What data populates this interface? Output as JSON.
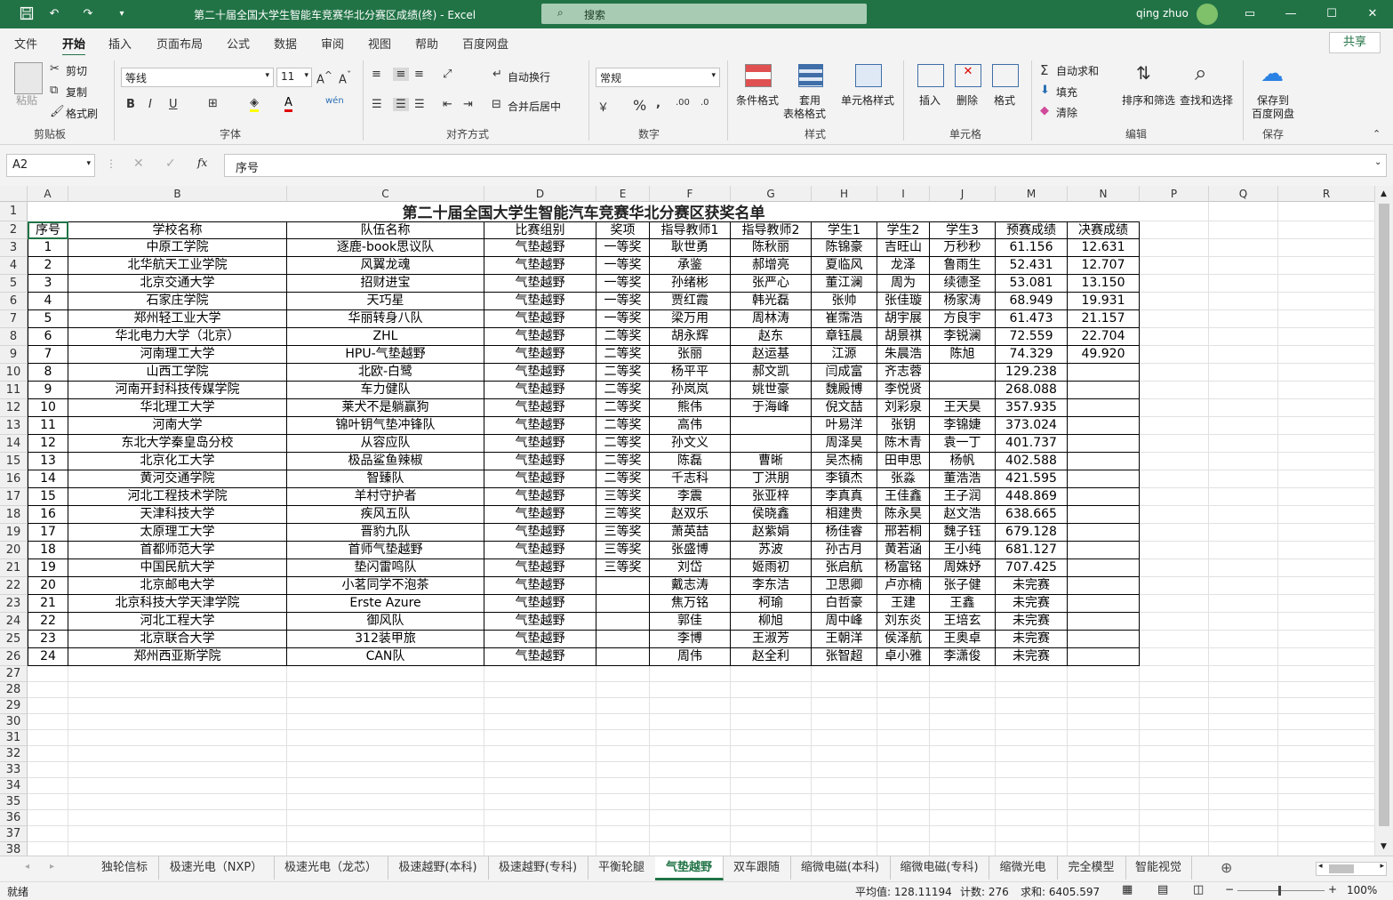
{
  "app": {
    "title": "第二十届全国大学生智能车竞赛华北分赛区成绩(终) - Excel",
    "search_placeholder": "搜索",
    "user": "qing zhuo",
    "accent": "#217346"
  },
  "ribbon": {
    "tabs": [
      "文件",
      "开始",
      "插入",
      "页面布局",
      "公式",
      "数据",
      "审阅",
      "视图",
      "帮助",
      "百度网盘"
    ],
    "active_tab": "开始",
    "share": "共享",
    "clipboard": {
      "paste": "粘贴",
      "cut": "剪切",
      "copy": "复制",
      "format_painter": "格式刷",
      "label": "剪贴板"
    },
    "font": {
      "name": "等线",
      "size": "11",
      "label": "字体"
    },
    "alignment": {
      "wrap": "自动换行",
      "merge": "合并后居中",
      "label": "对齐方式"
    },
    "number": {
      "format": "常规",
      "label": "数字"
    },
    "styles": {
      "conditional": "条件格式",
      "table_line1": "套用",
      "table_line2": "表格格式",
      "cell_styles": "单元格样式",
      "label": "样式"
    },
    "cells": {
      "insert": "插入",
      "delete": "删除",
      "format": "格式",
      "label": "单元格"
    },
    "editing": {
      "autosum": "自动求和",
      "fill": "填充",
      "clear": "清除",
      "sort": "排序和筛选",
      "find": "查找和选择",
      "label": "编辑"
    },
    "save": {
      "line1": "保存到",
      "line2": "百度网盘",
      "label": "保存"
    }
  },
  "formula_bar": {
    "name_box": "A2",
    "fx": "fx",
    "content": "序号"
  },
  "columns": [
    "A",
    "B",
    "C",
    "D",
    "E",
    "F",
    "G",
    "H",
    "I",
    "J",
    "M",
    "N",
    "P",
    "Q",
    "R"
  ],
  "sheet_title": "第二十届全国大学生智能汽车竞赛华北分赛区获奖名单",
  "table": {
    "headers": [
      "序号",
      "学校名称",
      "队伍名称",
      "比赛组别",
      "奖项",
      "指导教师1",
      "指导教师2",
      "学生1",
      "学生2",
      "学生3",
      "预赛成绩",
      "决赛成绩"
    ],
    "rows": [
      [
        "1",
        "中原工学院",
        "逐鹿-book思议队",
        "气垫越野",
        "一等奖",
        "耿世勇",
        "陈秋丽",
        "陈锦豪",
        "吉旺山",
        "万秒秒",
        "61.156",
        "12.631"
      ],
      [
        "2",
        "北华航天工业学院",
        "风翼龙魂",
        "气垫越野",
        "一等奖",
        "承鉴",
        "郝增亮",
        "夏临风",
        "龙泽",
        "鲁雨生",
        "52.431",
        "12.707"
      ],
      [
        "3",
        "北京交通大学",
        "招财进宝",
        "气垫越野",
        "一等奖",
        "孙绪彬",
        "张严心",
        "董江澜",
        "周为",
        "续德圣",
        "53.081",
        "13.150"
      ],
      [
        "4",
        "石家庄学院",
        "天巧星",
        "气垫越野",
        "一等奖",
        "贾红霞",
        "韩光磊",
        "张帅",
        "张佳璇",
        "杨家涛",
        "68.949",
        "19.931"
      ],
      [
        "5",
        "郑州轻工业大学",
        "华丽转身八队",
        "气垫越野",
        "一等奖",
        "梁万用",
        "周林涛",
        "崔霈浩",
        "胡宇展",
        "方良宇",
        "61.473",
        "21.157"
      ],
      [
        "6",
        "华北电力大学（北京）",
        "ZHL",
        "气垫越野",
        "二等奖",
        "胡永辉",
        "赵东",
        "章钰晨",
        "胡景祺",
        "李锐澜",
        "72.559",
        "22.704"
      ],
      [
        "7",
        "河南理工大学",
        "HPU-气垫越野",
        "气垫越野",
        "二等奖",
        "张丽",
        "赵运基",
        "江源",
        "朱晨浩",
        "陈旭",
        "74.329",
        "49.920"
      ],
      [
        "8",
        "山西工学院",
        "北欧-白鹭",
        "气垫越野",
        "二等奖",
        "杨平平",
        "郝文凯",
        "闫成富",
        "齐志蓉",
        "",
        "129.238",
        ""
      ],
      [
        "9",
        "河南开封科技传媒学院",
        "车力健队",
        "气垫越野",
        "二等奖",
        "孙岚岚",
        "姚世豪",
        "魏殿博",
        "李悦贤",
        "",
        "268.088",
        ""
      ],
      [
        "10",
        "华北理工大学",
        "莱犬不是躺赢狗",
        "气垫越野",
        "二等奖",
        "熊伟",
        "于海峰",
        "倪文喆",
        "刘彩泉",
        "王天昊",
        "357.935",
        ""
      ],
      [
        "11",
        "河南大学",
        "锦叶钥气垫冲锋队",
        "气垫越野",
        "二等奖",
        "高伟",
        "",
        "叶易洋",
        "张钥",
        "李锦婕",
        "373.024",
        ""
      ],
      [
        "12",
        "东北大学秦皇岛分校",
        "从容应队",
        "气垫越野",
        "二等奖",
        "孙文义",
        "",
        "周泽昊",
        "陈木青",
        "袁一丁",
        "401.737",
        ""
      ],
      [
        "13",
        "北京化工大学",
        "极品鲨鱼辣椒",
        "气垫越野",
        "二等奖",
        "陈磊",
        "曹晰",
        "吴杰楠",
        "田申思",
        "杨帆",
        "402.588",
        ""
      ],
      [
        "14",
        "黄河交通学院",
        "智臻队",
        "气垫越野",
        "二等奖",
        "千志科",
        "丁洪朋",
        "李镇杰",
        "张淼",
        "董浩浩",
        "421.595",
        ""
      ],
      [
        "15",
        "河北工程技术学院",
        "羊村守护者",
        "气垫越野",
        "三等奖",
        "李震",
        "张亚梓",
        "李真真",
        "王佳鑫",
        "王子润",
        "448.869",
        ""
      ],
      [
        "16",
        "天津科技大学",
        "疾风五队",
        "气垫越野",
        "三等奖",
        "赵双乐",
        "侯晓鑫",
        "相建贵",
        "陈永昊",
        "赵文浩",
        "638.665",
        ""
      ],
      [
        "17",
        "太原理工大学",
        "晋豹九队",
        "气垫越野",
        "三等奖",
        "萧英喆",
        "赵紫娟",
        "杨佳睿",
        "邢若桐",
        "魏子钰",
        "679.128",
        ""
      ],
      [
        "18",
        "首都师范大学",
        "首师气垫越野",
        "气垫越野",
        "三等奖",
        "张盛博",
        "苏波",
        "孙古月",
        "黄若涵",
        "王小纯",
        "681.127",
        ""
      ],
      [
        "19",
        "中国民航大学",
        "垫闪雷鸣队",
        "气垫越野",
        "三等奖",
        "刘岱",
        "姬雨初",
        "张启航",
        "杨富铭",
        "周姝妤",
        "707.425",
        ""
      ],
      [
        "20",
        "北京邮电大学",
        "小茗同学不泡茶",
        "气垫越野",
        "",
        "戴志涛",
        "李东洁",
        "卫思卿",
        "卢亦楠",
        "张子健",
        "未完赛",
        ""
      ],
      [
        "21",
        "北京科技大学天津学院",
        "Erste Azure",
        "气垫越野",
        "",
        "焦万铭",
        "柯瑜",
        "白哲豪",
        "王建",
        "王鑫",
        "未完赛",
        ""
      ],
      [
        "22",
        "河北工程大学",
        "御风队",
        "气垫越野",
        "",
        "郭佳",
        "柳旭",
        "周中峰",
        "刘东炎",
        "王培玄",
        "未完赛",
        ""
      ],
      [
        "23",
        "北京联合大学",
        "312装甲旅",
        "气垫越野",
        "",
        "李博",
        "王淑芳",
        "王朝洋",
        "侯泽航",
        "王奥卓",
        "未完赛",
        ""
      ],
      [
        "24",
        "郑州西亚斯学院",
        "CAN队",
        "气垫越野",
        "",
        "周伟",
        "赵全利",
        "张智超",
        "卓小雅",
        "李潇俊",
        "未完赛",
        ""
      ]
    ]
  },
  "row_numbers": [
    "1",
    "2",
    "3",
    "4",
    "5",
    "6",
    "7",
    "8",
    "9",
    "10",
    "11",
    "12",
    "13",
    "14",
    "15",
    "16",
    "17",
    "18",
    "19",
    "20",
    "21",
    "22",
    "23",
    "24",
    "25",
    "26",
    "27",
    "28",
    "29",
    "30",
    "31",
    "32",
    "33",
    "34",
    "35",
    "36",
    "37",
    "38"
  ],
  "sheet_tabs": [
    "独轮信标",
    "极速光电（NXP）",
    "极速光电（龙芯）",
    "极速越野(本科)",
    "极速越野(专科)",
    "平衡轮腿",
    "气垫越野",
    "双车跟随",
    "缩微电磁(本科)",
    "缩微电磁(专科)",
    "缩微光电",
    "完全模型",
    "智能视觉"
  ],
  "active_sheet": "气垫越野",
  "status": {
    "ready": "就绪",
    "average": "平均值: 128.11194",
    "count": "计数: 276",
    "sum": "求和: 6405.597",
    "zoom": "100%"
  }
}
